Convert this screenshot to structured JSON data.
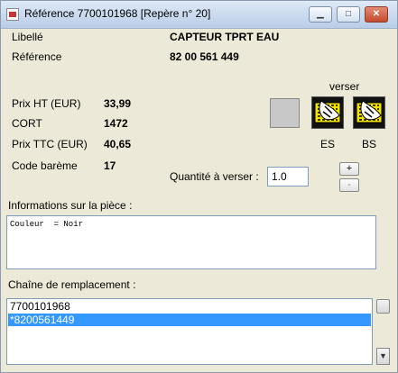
{
  "window": {
    "title": "Référence 7700101968 [Repère n° 20]",
    "minimize_icon": "minimize-icon",
    "maximize_icon": "maximize-icon",
    "close_icon": "close-icon"
  },
  "details": {
    "libelle_label": "Libellé",
    "libelle_value": "CAPTEUR TPRT EAU",
    "reference_label": "Référence",
    "reference_value": "82 00 561 449"
  },
  "prices": {
    "prix_ht_label": "Prix HT (EUR)",
    "prix_ht_value": "33,99",
    "cort_label": "CORT",
    "cort_value": "1472",
    "prix_ttc_label": "Prix TTC (EUR)",
    "prix_ttc_value": "40,65",
    "code_bareme_label": "Code barème",
    "code_bareme_value": "17"
  },
  "verser": {
    "heading": "verser",
    "es_label": "ES",
    "bs_label": "BS"
  },
  "quantity": {
    "label": "Quantité à verser :",
    "value": "1.0",
    "increment_label": "+",
    "decrement_label": "-"
  },
  "info": {
    "label": "Informations sur la pièce :",
    "text": "Couleur  = Noir"
  },
  "replacement": {
    "label": "Chaîne de remplacement :",
    "items": [
      "7700101968",
      "*8200561449"
    ],
    "selected_index": 1
  },
  "colors": {
    "selection": "#3399ff",
    "window_bg": "#ece9d8",
    "stamp_yellow": "#f2e200"
  }
}
